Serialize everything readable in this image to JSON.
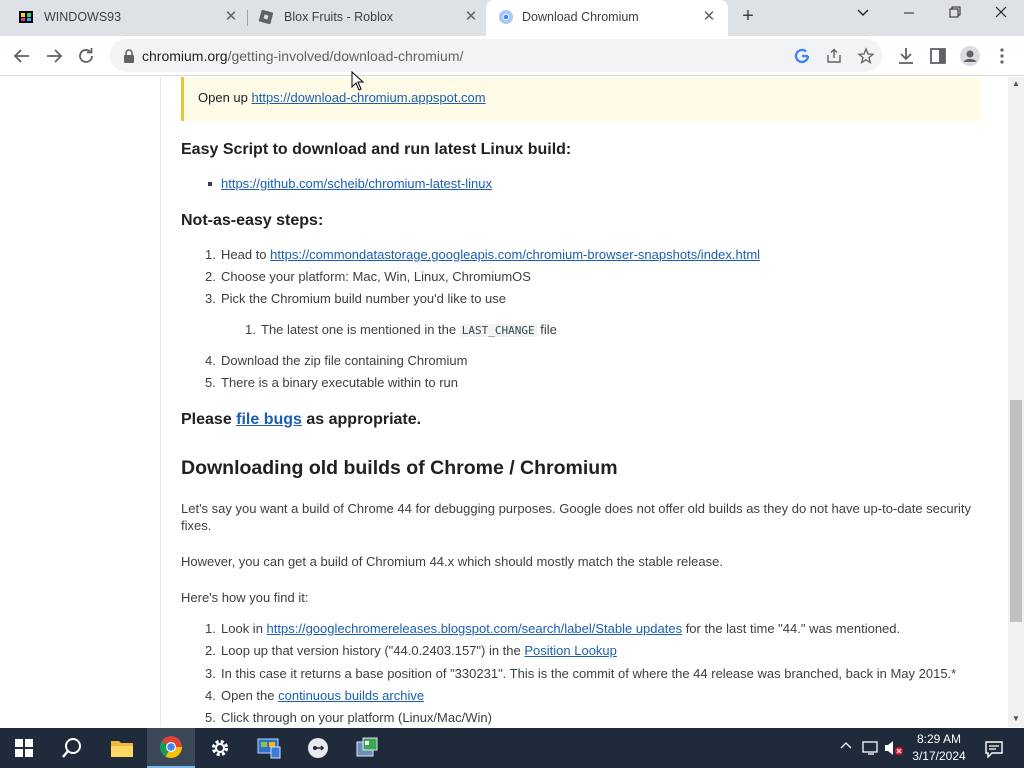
{
  "tabs": [
    {
      "title": "WINDOWS93",
      "active": false
    },
    {
      "title": "Blox Fruits - Roblox",
      "active": false
    },
    {
      "title": "Download Chromium",
      "active": true
    }
  ],
  "toolbar": {
    "url_host": "chromium.org",
    "url_path": "/getting-involved/download-chromium/"
  },
  "content": {
    "notice_prefix": "Open up ",
    "notice_link": "https://download-chromium.appspot.com",
    "easy_heading": "Easy Script to download and run latest Linux build:",
    "easy_link": "https://github.com/scheib/chromium-latest-linux",
    "steps_heading": "Not-as-easy steps:",
    "step1_prefix": "Head to ",
    "step1_link": "https://commondatastorage.googleapis.com/chromium-browser-snapshots/index.html",
    "step2": "Choose your platform: Mac, Win, Linux, ChromiumOS",
    "step3": "Pick the Chromium build number you'd like to use",
    "substep1_prefix": "The latest one is mentioned in the ",
    "substep1_code": "LAST_CHANGE",
    "substep1_suffix": " file",
    "step4": "Download the zip file containing Chromium",
    "step5": "There is a binary executable within to run",
    "please_prefix": "Please ",
    "please_link": "file bugs",
    "please_suffix": " as appropriate.",
    "old_heading": "Downloading old builds of Chrome / Chromium",
    "para1": "Let's say you want a build of Chrome 44 for debugging purposes. Google does not offer old builds as they do not have up-to-date security fixes.",
    "para2": "However, you can get a build of Chromium 44.x which should mostly match the stable release.",
    "para3": "Here's how you find it:",
    "old1_prefix": "Look in ",
    "old1_link": "https://googlechromereleases.blogspot.com/search/label/Stable updates",
    "old1_suffix": " for the last time \"44.\" was mentioned.",
    "old2_prefix": "Loop up that version history (\"44.0.2403.157\") in the ",
    "old2_link": "Position Lookup",
    "old3": "In this case it returns a base position of \"330231\". This is the commit of where the 44 release was branched, back in May 2015.*",
    "old4_prefix": "Open the ",
    "old4_link": "continuous builds archive",
    "old5": "Click through on your platform (Linux/Mac/Win)"
  },
  "numbers": {
    "n1": "1.",
    "n2": "2.",
    "n3": "3.",
    "n4": "4.",
    "n5": "5."
  },
  "taskbar": {
    "time": "8:29 AM",
    "date": "3/17/2024"
  }
}
